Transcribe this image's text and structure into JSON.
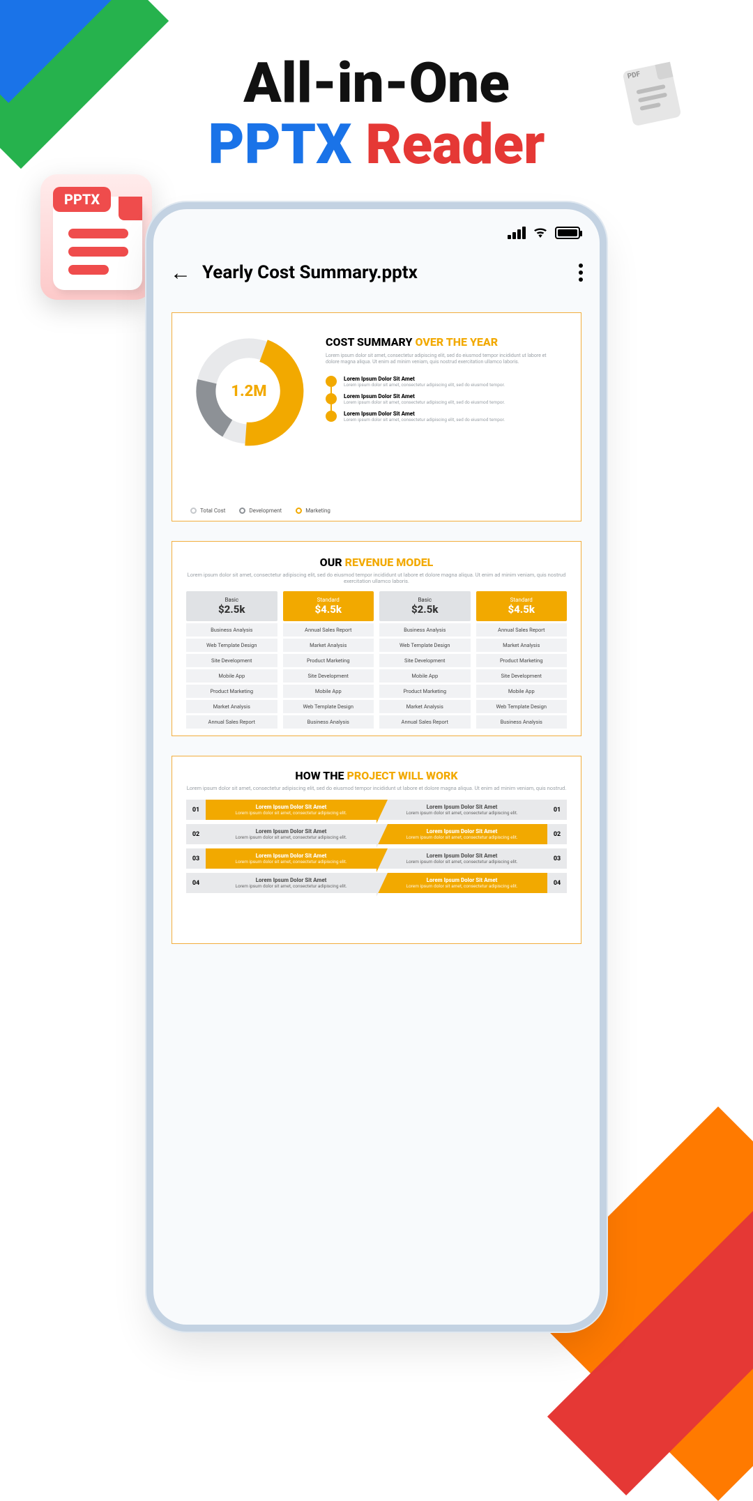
{
  "headline": {
    "line1": "All-in-One",
    "pptx": "PPTX",
    "reader": "Reader"
  },
  "pdf_label": "PDF",
  "pptx_icon_label": "PPTX",
  "phone": {
    "file_title": "Yearly Cost Summary.pptx"
  },
  "slide1": {
    "title_a": "COST SUMMARY ",
    "title_b": "OVER THE YEAR",
    "donut_center": "1.2M",
    "legend": [
      "Total Cost",
      "Development",
      "Marketing"
    ],
    "points": [
      {
        "t": "Lorem Ipsum Dolor Sit Amet",
        "s": "Lorem ipsum dolor sit amet, consectetur adipiscing elit, sed do eiusmod tempor."
      },
      {
        "t": "Lorem Ipsum Dolor Sit Amet",
        "s": "Lorem ipsum dolor sit amet, consectetur adipiscing elit, sed do eiusmod tempor."
      },
      {
        "t": "Lorem Ipsum Dolor Sit Amet",
        "s": "Lorem ipsum dolor sit amet, consectetur adipiscing elit, sed do eiusmod tempor."
      }
    ]
  },
  "chart_data": {
    "type": "pie",
    "title": "Cost Summary Over The Year",
    "center_label": "1.2M",
    "series": [
      {
        "name": "Marketing",
        "value": 45
      },
      {
        "name": "Total Cost",
        "value": 35
      },
      {
        "name": "Development",
        "value": 20
      }
    ]
  },
  "slide2": {
    "title_a": "OUR ",
    "title_b": "REVENUE MODEL",
    "cols": [
      {
        "plan": "Basic",
        "amt": "$2.5k",
        "style": "ph-gray",
        "rows": [
          "Business Analysis",
          "Web Template Design",
          "Site Development",
          "Mobile App",
          "Product Marketing",
          "Market Analysis",
          "Annual Sales Report"
        ]
      },
      {
        "plan": "Standard",
        "amt": "$4.5k",
        "style": "ph-or",
        "rows": [
          "Annual Sales Report",
          "Market Analysis",
          "Product Marketing",
          "Site Development",
          "Mobile App",
          "Web Template Design",
          "Business Analysis"
        ]
      },
      {
        "plan": "Basic",
        "amt": "$2.5k",
        "style": "ph-gray",
        "rows": [
          "Business Analysis",
          "Web Template Design",
          "Site Development",
          "Mobile App",
          "Product Marketing",
          "Market Analysis",
          "Annual Sales Report"
        ]
      },
      {
        "plan": "Standard",
        "amt": "$4.5k",
        "style": "ph-or",
        "rows": [
          "Annual Sales Report",
          "Market Analysis",
          "Product Marketing",
          "Site Development",
          "Mobile App",
          "Web Template Design",
          "Business Analysis"
        ]
      }
    ]
  },
  "slide3": {
    "title_a": "HOW THE ",
    "title_b": "PROJECT WILL WORK",
    "steps": [
      {
        "n": "01",
        "t": "Lorem Ipsum Dolor Sit Amet",
        "s": "Lorem ipsum dolor sit amet, consectetur adipiscing elit."
      },
      {
        "n": "02",
        "t": "Lorem Ipsum Dolor Sit Amet",
        "s": "Lorem ipsum dolor sit amet, consectetur adipiscing elit."
      },
      {
        "n": "03",
        "t": "Lorem Ipsum Dolor Sit Amet",
        "s": "Lorem ipsum dolor sit amet, consectetur adipiscing elit."
      },
      {
        "n": "04",
        "t": "Lorem Ipsum Dolor Sit Amet",
        "s": "Lorem ipsum dolor sit amet, consectetur adipiscing elit."
      }
    ]
  }
}
